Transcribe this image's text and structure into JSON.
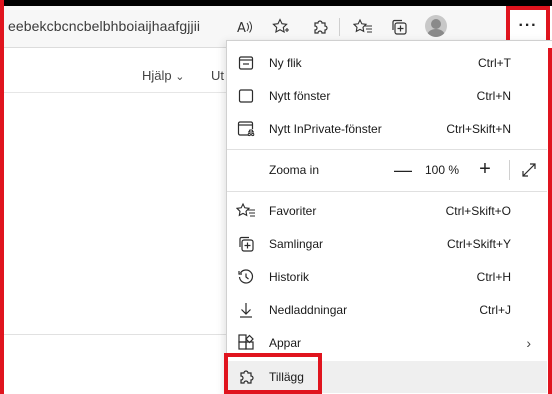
{
  "address_bar": {
    "url": "eebekcbcncbelbhboiaijhaafgjjii"
  },
  "toolbar": {
    "icons": [
      {
        "name": "read-aloud-icon",
        "glyph": "A⁾"
      },
      {
        "name": "favorites-add-icon",
        "glyph": "☆"
      },
      {
        "name": "extensions-icon",
        "glyph": "puzzle"
      },
      {
        "name": "favorites-icon",
        "glyph": "☆"
      },
      {
        "name": "collections-icon",
        "glyph": "collections"
      },
      {
        "name": "profile-icon",
        "glyph": "avatar"
      }
    ],
    "more_label": "···"
  },
  "page": {
    "help_label": "Hjälp",
    "help_chevron": "⌄",
    "ut_label": "Ut"
  },
  "menu": {
    "new_tab": {
      "label": "Ny flik",
      "shortcut": "Ctrl+T"
    },
    "new_window": {
      "label": "Nytt fönster",
      "shortcut": "Ctrl+N"
    },
    "inprivate": {
      "label": "Nytt InPrivate-fönster",
      "shortcut": "Ctrl+Skift+N"
    },
    "zoom": {
      "label": "Zooma in",
      "minus": "—",
      "value": "100 %",
      "plus": "+"
    },
    "favorites": {
      "label": "Favoriter",
      "shortcut": "Ctrl+Skift+O"
    },
    "collections": {
      "label": "Samlingar",
      "shortcut": "Ctrl+Skift+Y"
    },
    "history": {
      "label": "Historik",
      "shortcut": "Ctrl+H"
    },
    "downloads": {
      "label": "Nedladdningar",
      "shortcut": "Ctrl+J"
    },
    "apps": {
      "label": "Appar",
      "chevron": "›"
    },
    "extensions": {
      "label": "Tillägg"
    }
  },
  "colors": {
    "highlight": "#e0141e",
    "hover": "#efefef"
  }
}
